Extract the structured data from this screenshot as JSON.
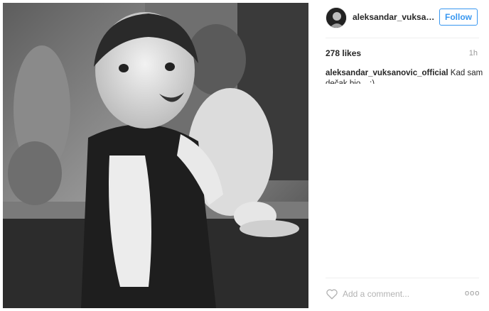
{
  "post": {
    "username": "aleksandar_vuksanovic_official",
    "follow_label": "Follow",
    "likes": "278 likes",
    "time_ago": "1h",
    "caption_user": "aleksandar_vuksanovic_official",
    "caption_text": "Kad sam dečak bio... :)",
    "comment_placeholder": "Add a comment...",
    "more_label": "ooo"
  },
  "icons": {
    "avatar": "avatar-icon",
    "like": "heart-icon",
    "more": "more-options-icon"
  },
  "colors": {
    "accent": "#3897f0",
    "text": "#262626",
    "muted": "#999999",
    "divider": "#efefef"
  }
}
